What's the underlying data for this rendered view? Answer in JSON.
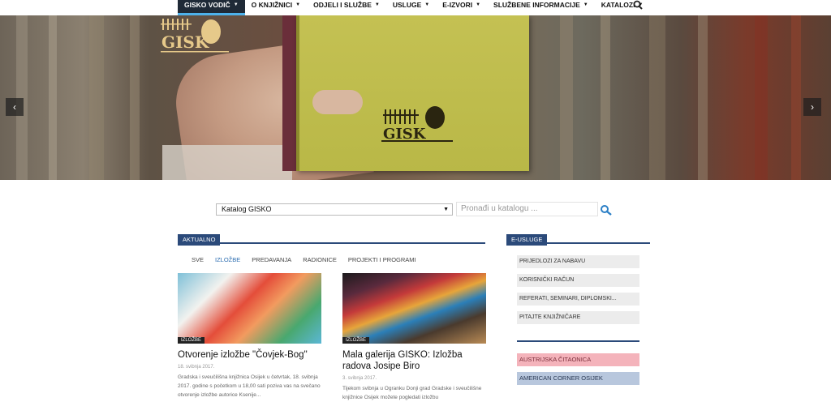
{
  "nav": {
    "items": [
      {
        "label": "GISKO VODIČ",
        "active": true
      },
      {
        "label": "O KNJIŽNICI",
        "active": false
      },
      {
        "label": "ODJELI I SLUŽBE",
        "active": false
      },
      {
        "label": "USLUGE",
        "active": false
      },
      {
        "label": "E-IZVORI",
        "active": false
      },
      {
        "label": "SLUŽBENE INFORMACIJE",
        "active": false
      },
      {
        "label": "KATALOZI",
        "active": false
      }
    ]
  },
  "hero": {
    "logo_text": "GISK",
    "book_logo_text": "GISK",
    "prev_arrow": "‹",
    "next_arrow": "›"
  },
  "catalog": {
    "selected": "Katalog GISKO",
    "placeholder": "Pronađi u katalogu ..."
  },
  "aktualno": {
    "heading": "AKTUALNO",
    "filters": [
      {
        "label": "SVE",
        "active": false
      },
      {
        "label": "IZLOŽBE",
        "active": true
      },
      {
        "label": "PREDAVANJA",
        "active": false
      },
      {
        "label": "RADIONICE",
        "active": false
      },
      {
        "label": "PROJEKTI I PROGRAMI",
        "active": false
      }
    ],
    "posts": [
      {
        "badge": "IZLOŽBE",
        "title": "Otvorenje izložbe \"Čovjek-Bog\"",
        "date": "18. svibnja 2017.",
        "excerpt": "Gradska i sveučilišna knjižnica Osijek u četvrtak, 18. svibnja 2017. godine s početkom u 18,00 sati poziva vas na svečano otvorenje izložbe autorice Ksenije..."
      },
      {
        "badge": "IZLOŽBE",
        "title": "Mala galerija GISKO: Izložba radova Josipe Biro",
        "date": "3. svibnja 2017.",
        "excerpt": "Tijekom svibnja u Ogranku Donji grad Gradske i sveučilišne knjižnice Osijek možete pogledati izložbu"
      }
    ]
  },
  "eusluge": {
    "heading": "E-USLUGE",
    "items": [
      "PRIJEDLOZI ZA NABAVU",
      "KORISNIČKI RAČUN",
      "REFERATI, SEMINARI, DIPLOMSKI...",
      "PITAJTE KNJIŽNIČARE"
    ],
    "austria": "AUSTRIJSKA ČITAONICA",
    "american": "AMERICAN CORNER OSIJEK"
  }
}
